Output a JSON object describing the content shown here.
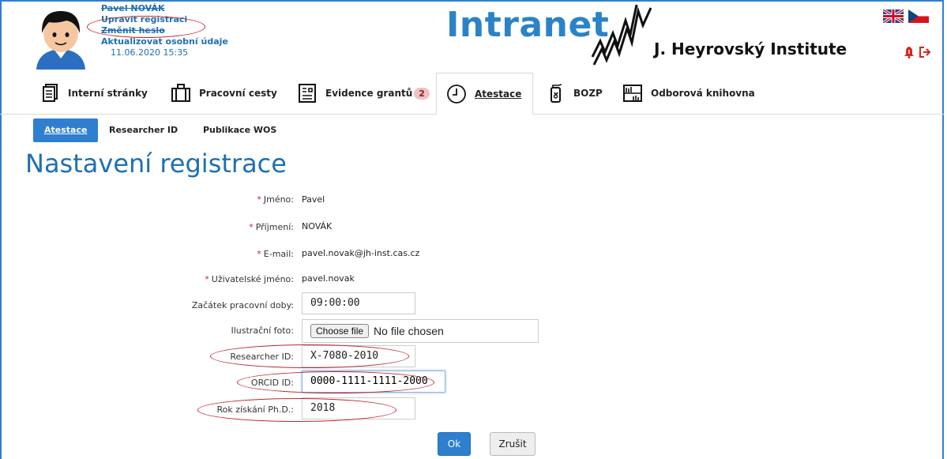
{
  "user": {
    "name": "Pavel NOVÁK",
    "edit_registration": "Upravit registraci",
    "change_password": "Změnit heslo",
    "update_personal": "Aktualizovat osobní údaje",
    "datetime": "11.06.2020 15:35"
  },
  "logo": {
    "intranet": "Intranet",
    "institute": "J. Heyrovský Institute"
  },
  "tabs": [
    {
      "label": "Interní stránky",
      "icon": "documents-icon"
    },
    {
      "label": "Pracovní cesty",
      "icon": "suitcase-icon"
    },
    {
      "label": "Evidence grantů",
      "icon": "grant-form-icon",
      "badge": "2"
    },
    {
      "label": "Atestace",
      "icon": "clock-icon",
      "active": true
    },
    {
      "label": "BOZP",
      "icon": "fire-extinguisher-icon"
    },
    {
      "label": "Odborová knihovna",
      "icon": "library-icon"
    }
  ],
  "subnav": [
    "Atestace",
    "Researcher ID",
    "Publikace WOS"
  ],
  "page_title": "Nastavení registrace",
  "form": {
    "first_name": {
      "label": "Jméno:",
      "value": "Pavel"
    },
    "last_name": {
      "label": "Příjmení:",
      "value": "NOVÁK"
    },
    "email": {
      "label": "E-mail:",
      "value": "pavel.novak@jh-inst.cas.cz"
    },
    "username": {
      "label": "Uživatelské jméno:",
      "value": "pavel.novak"
    },
    "work_start": {
      "label": "Začátek pracovní doby:",
      "value": "09:00:00"
    },
    "photo": {
      "label": "Ilustrační foto:",
      "button": "Choose file",
      "status": "No file chosen"
    },
    "researcher_id": {
      "label": "Researcher ID:",
      "value": "X-7080-2010"
    },
    "orcid": {
      "label": "ORCID ID:",
      "value": "0000-1111-1111-2000"
    },
    "phd_year": {
      "label": "Rok získání Ph.D.:",
      "value": "2018"
    },
    "required_mark": "*"
  },
  "actions": {
    "ok": "Ok",
    "cancel": "Zrušit"
  },
  "colors": {
    "accent": "#2e7fd0",
    "title": "#1f6fb2",
    "highlight_oval": "#c0272d",
    "required": "#c0272d"
  }
}
